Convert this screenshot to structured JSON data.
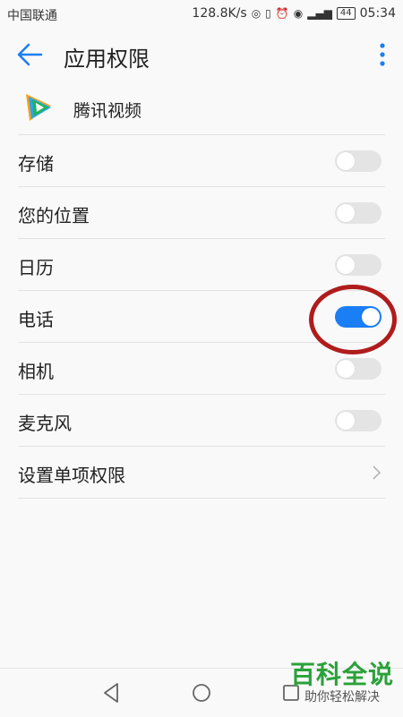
{
  "status_bar": {
    "carrier": "中国联通",
    "speed": "128.8K/s",
    "battery": "44",
    "time": "05:34"
  },
  "app_bar": {
    "title": "应用权限",
    "back_icon": "arrow-left-icon",
    "more_icon": "more-vert-icon"
  },
  "app": {
    "name": "腾讯视频",
    "icon": "tencent-video-icon"
  },
  "permissions": [
    {
      "label": "存储",
      "enabled": false
    },
    {
      "label": "您的位置",
      "enabled": false
    },
    {
      "label": "日历",
      "enabled": false
    },
    {
      "label": "电话",
      "enabled": true
    },
    {
      "label": "相机",
      "enabled": false
    },
    {
      "label": "麦克风",
      "enabled": false
    }
  ],
  "set_individual": {
    "label": "设置单项权限"
  },
  "nav": {
    "back": "nav-back-icon",
    "home": "nav-home-icon",
    "recent": "nav-recent-icon"
  },
  "watermark": {
    "title": "百科全说",
    "subtitle": "助你轻松解决"
  },
  "colors": {
    "accent": "#1a7ef5",
    "toggle_off": "#e4e4e4",
    "highlight": "#b01c1c",
    "watermark": "#2aa13a"
  }
}
